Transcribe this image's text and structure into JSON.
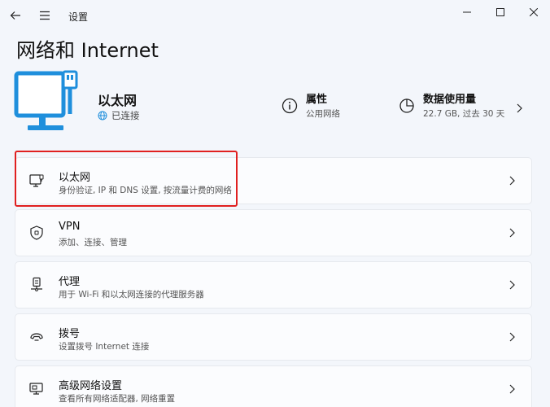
{
  "window": {
    "app_title": "设置",
    "back_icon": "arrow-left-icon",
    "menu_icon": "hamburger-icon",
    "controls": [
      "minimize-icon",
      "maximize-icon",
      "close-icon"
    ]
  },
  "page": {
    "title": "网络和 Internet"
  },
  "connection": {
    "name": "以太网",
    "status": "已连接",
    "icon": "monitor-ethernet-icon",
    "status_icon": "globe-icon"
  },
  "hero_items": [
    {
      "title": "属性",
      "subtitle": "公用网络",
      "icon": "info-icon"
    },
    {
      "title": "数据使用量",
      "subtitle": "22.7 GB, 过去 30 天",
      "icon": "data-usage-icon"
    }
  ],
  "settings_items": [
    {
      "title": "以太网",
      "subtitle": "身份验证, IP 和 DNS 设置, 按流量计费的网络",
      "icon": "ethernet-icon",
      "highlighted": true
    },
    {
      "title": "VPN",
      "subtitle": "添加、连接、管理",
      "icon": "shield-icon"
    },
    {
      "title": "代理",
      "subtitle": "用于 Wi-Fi 和以太网连接的代理服务器",
      "icon": "proxy-icon"
    },
    {
      "title": "拨号",
      "subtitle": "设置拨号 Internet 连接",
      "icon": "dialup-icon"
    },
    {
      "title": "高级网络设置",
      "subtitle": "查看所有网络适配器, 网络重置",
      "icon": "advanced-network-icon"
    }
  ],
  "colors": {
    "accent": "#1f8fdc",
    "highlight": "#e02020",
    "background": "#f3f6fb"
  }
}
